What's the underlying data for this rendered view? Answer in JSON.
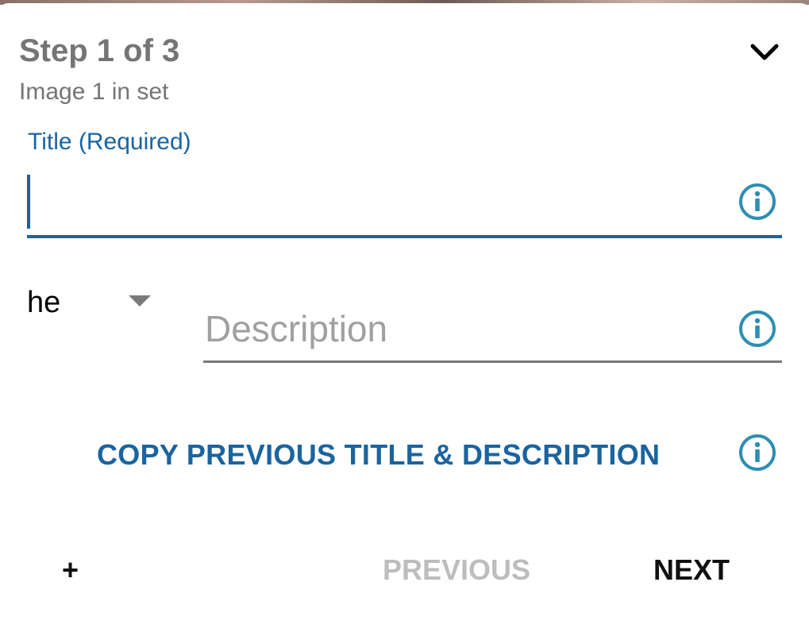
{
  "header": {
    "step_title": "Step 1 of 3",
    "subtitle": "Image 1 in set",
    "collapse_icon": "chevron-down-icon"
  },
  "title_field": {
    "label": "Title (Required)",
    "value": "",
    "info_icon": "info-icon"
  },
  "description_field": {
    "language": "he",
    "placeholder": "Description",
    "value": "",
    "info_icon": "info-icon"
  },
  "copy_previous": {
    "label": "COPY PREVIOUS TITLE & DESCRIPTION",
    "info_icon": "info-icon"
  },
  "footer": {
    "add_label": "+",
    "previous_label": "PREVIOUS",
    "next_label": "NEXT"
  },
  "colors": {
    "accent": "#1a64a0",
    "info_icon": "#2d8fb0",
    "text_secondary": "#757575",
    "disabled": "#bdbdbd"
  }
}
